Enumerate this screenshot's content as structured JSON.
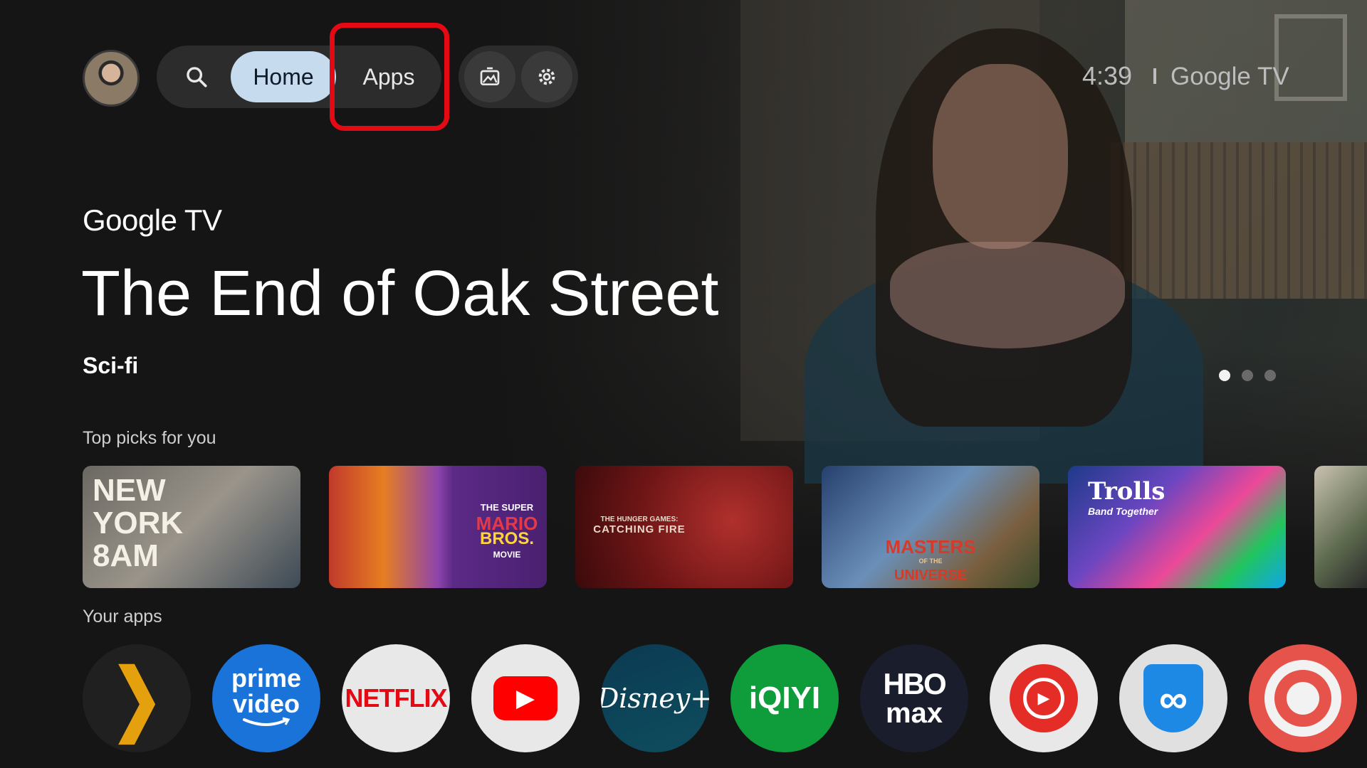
{
  "nav": {
    "profile_icon": "avatar",
    "search_icon": "search-icon",
    "home_label": "Home",
    "apps_label": "Apps",
    "ambient_icon": "ambient-mode-icon",
    "settings_icon": "settings-icon"
  },
  "status": {
    "time": "4:39",
    "brand": "Google TV"
  },
  "hero": {
    "brand": "Google TV",
    "title": "The End of Oak Street",
    "genre": "Sci-fi",
    "carousel_dots": 3,
    "active_dot": 1
  },
  "top_picks": {
    "label": "Top picks for you",
    "items": [
      {
        "title": "NEW YORK 8AM",
        "lines": [
          "NEW",
          "YORK",
          "8AM"
        ]
      },
      {
        "title": "The Super Mario Bros. Movie",
        "lines": [
          "THE SUPER",
          "MARIO",
          "BROS.",
          "MOVIE"
        ]
      },
      {
        "title": "The Hunger Games: Catching Fire",
        "lines": [
          "THE HUNGER GAMES:",
          "CATCHING FIRE"
        ]
      },
      {
        "title": "Masters of the Universe",
        "lines": [
          "MASTERS",
          "OF THE",
          "UNIVERSE"
        ]
      },
      {
        "title": "Trolls Band Together",
        "lines": [
          "Trolls",
          "Band Together"
        ]
      }
    ]
  },
  "your_apps": {
    "label": "Your apps",
    "items": [
      {
        "name": "Plex",
        "glyph": "❯"
      },
      {
        "name": "Prime Video",
        "line1": "prime",
        "line2": "video"
      },
      {
        "name": "Netflix",
        "text": "NETFLIX"
      },
      {
        "name": "YouTube",
        "glyph": "▶"
      },
      {
        "name": "Disney+",
        "text": "Disney+"
      },
      {
        "name": "iQIYI",
        "text": "iQIYI"
      },
      {
        "name": "HBO Max",
        "line1": "HBO",
        "line2": "max"
      },
      {
        "name": "YouTube Music",
        "glyph": "▶"
      },
      {
        "name": "VPN",
        "glyph": "∞"
      },
      {
        "name": "Target",
        "glyph": "◎"
      }
    ]
  },
  "colors": {
    "home_pill": "#c7dbee",
    "highlight": "#e50914",
    "netflix_red": "#e50914",
    "prime_blue": "#1a73d9",
    "iqiyi_green": "#0f9d3c"
  }
}
